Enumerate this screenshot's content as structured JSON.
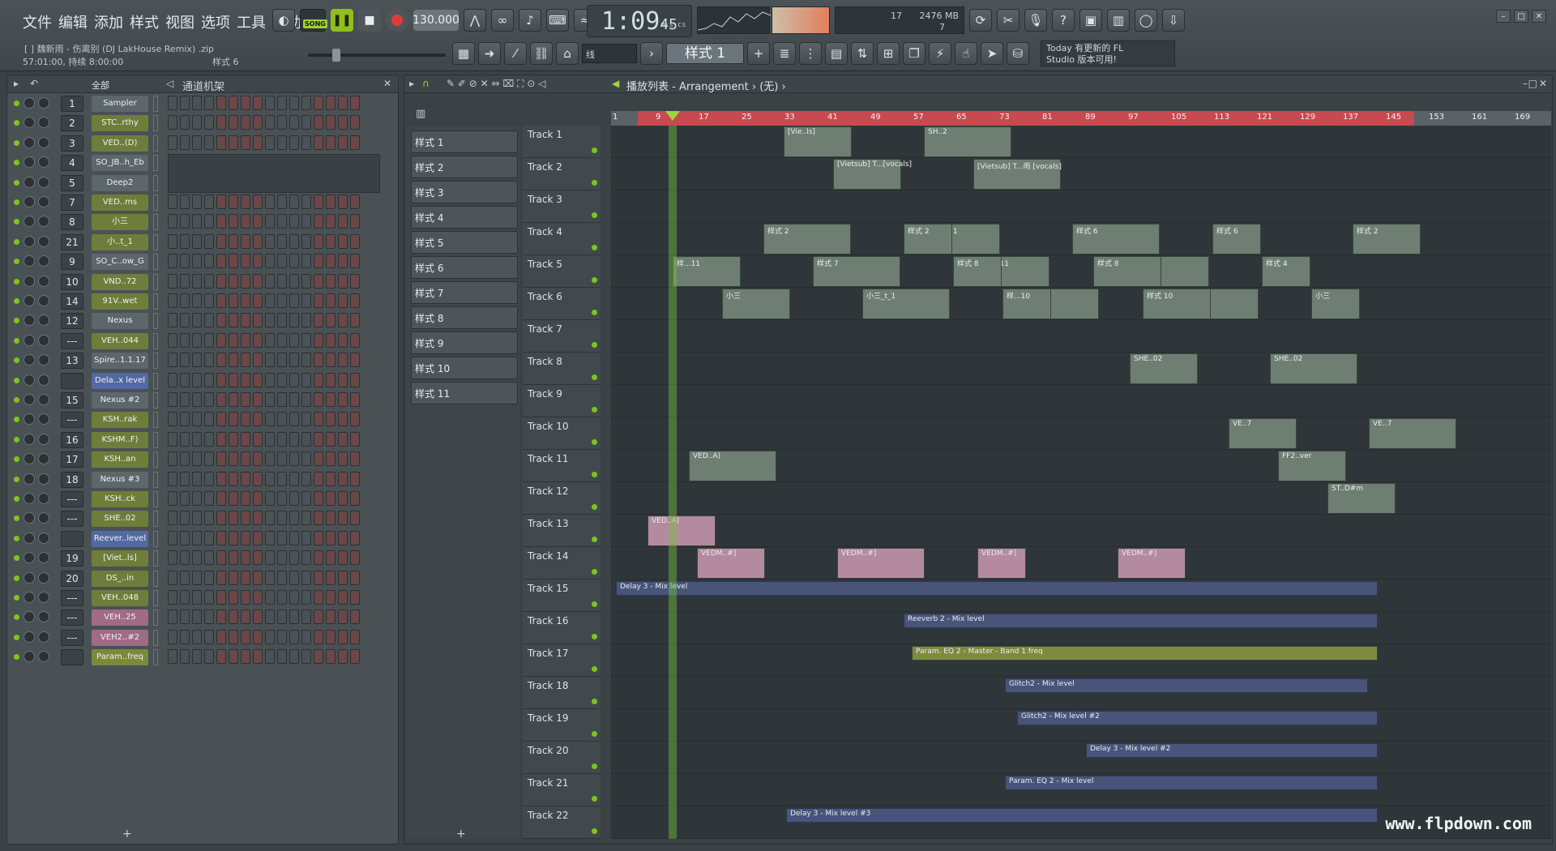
{
  "menu": [
    "文件",
    "编辑",
    "添加",
    "样式",
    "视图",
    "选项",
    "工具",
    "帮助"
  ],
  "song": {
    "title": "[ ] 魏新雨 - 伤离别 (DJ LakHouse Remix) .zip",
    "info": "57:01:00, 持续 8:00:00",
    "pattern": "样式 6"
  },
  "transport": {
    "song_mode": "SONG",
    "tempo": "130.000",
    "time": "1:09",
    "time_sub": "45",
    "time_unit": "M:S:CS"
  },
  "cpu": {
    "poly": "17",
    "mem": "2476 MB",
    "voices": "7"
  },
  "toolbar2": {
    "snap": "线",
    "pattern": "样式 1"
  },
  "news": {
    "line1": "Today  有更新的 FL",
    "line2": "Studio 版本可用!"
  },
  "rack": {
    "filter": "全部",
    "title": "通道机架",
    "channels": [
      {
        "num": "1",
        "name": "Sampler",
        "color": "#5d666a"
      },
      {
        "num": "2",
        "name": "STC..rthy",
        "color": "#6f7d3a"
      },
      {
        "num": "3",
        "name": "VED..(D)",
        "color": "#6f7d3a"
      },
      {
        "num": "4",
        "name": "SO_JB..h_Eb",
        "color": "#5d666a"
      },
      {
        "num": "5",
        "name": "Deep2",
        "color": "#5d666a"
      },
      {
        "num": "7",
        "name": "VED..ms",
        "color": "#6f7d3a"
      },
      {
        "num": "8",
        "name": "小三",
        "color": "#6f7d3a"
      },
      {
        "num": "21",
        "name": "小..t_1",
        "color": "#6f7d3a"
      },
      {
        "num": "9",
        "name": "SO_C..ow_G",
        "color": "#5d666a"
      },
      {
        "num": "10",
        "name": "VND..72",
        "color": "#6f7d3a"
      },
      {
        "num": "14",
        "name": "91V..wet",
        "color": "#6f7d3a"
      },
      {
        "num": "12",
        "name": "Nexus",
        "color": "#5d666a"
      },
      {
        "num": "---",
        "name": "VEH..044",
        "color": "#6f7d3a"
      },
      {
        "num": "13",
        "name": "Spire..1.1.17",
        "color": "#5d666a"
      },
      {
        "num": "",
        "name": "Dela..x level",
        "color": "#536aa0"
      },
      {
        "num": "15",
        "name": "Nexus #2",
        "color": "#5d666a"
      },
      {
        "num": "---",
        "name": "KSH..rak",
        "color": "#6f7d3a"
      },
      {
        "num": "16",
        "name": "KSHM..F)",
        "color": "#6f7d3a"
      },
      {
        "num": "17",
        "name": "KSH..an",
        "color": "#6f7d3a"
      },
      {
        "num": "18",
        "name": "Nexus #3",
        "color": "#5d666a"
      },
      {
        "num": "---",
        "name": "KSH..ck",
        "color": "#6f7d3a"
      },
      {
        "num": "---",
        "name": "SHE..02",
        "color": "#6f7d3a"
      },
      {
        "num": "",
        "name": "Reever..level",
        "color": "#536aa0"
      },
      {
        "num": "19",
        "name": "[Viet..ls]",
        "color": "#6f7d3a"
      },
      {
        "num": "20",
        "name": "DS_..in",
        "color": "#6f7d3a"
      },
      {
        "num": "---",
        "name": "VEH..048",
        "color": "#6f7d3a"
      },
      {
        "num": "---",
        "name": "VEH..25",
        "color": "#a06b86"
      },
      {
        "num": "---",
        "name": "VEH2..#2",
        "color": "#a06b86"
      },
      {
        "num": "",
        "name": "Param..freq",
        "color": "#7a8a3a"
      }
    ]
  },
  "playlist": {
    "title": "播放列表 - Arrangement › (无) ›",
    "patterns": [
      "样式 1",
      "样式 2",
      "样式 3",
      "样式 4",
      "样式 5",
      "样式 6",
      "样式 7",
      "样式 8",
      "样式 9",
      "样式 10",
      "样式 11"
    ],
    "tracks": [
      "Track 1",
      "Track 2",
      "Track 3",
      "Track 4",
      "Track 5",
      "Track 6",
      "Track 7",
      "Track 8",
      "Track 9",
      "Track 10",
      "Track 11",
      "Track 12",
      "Track 13",
      "Track 14",
      "Track 15",
      "Track 16",
      "Track 17",
      "Track 18",
      "Track 19",
      "Track 20",
      "Track 21",
      "Track 22"
    ],
    "ruler": [
      "1",
      "9",
      "17",
      "25",
      "33",
      "41",
      "49",
      "57",
      "65",
      "73",
      "81",
      "89",
      "97",
      "105",
      "113",
      "121",
      "129",
      "137",
      "145",
      "153",
      "161",
      "169"
    ],
    "automation": [
      {
        "track": 14,
        "label": "Delay 3 - Mix level"
      },
      {
        "track": 15,
        "label": "Reeverb 2 - Mix level"
      },
      {
        "track": 16,
        "label": "Param. EQ 2 - Master - Band 1 freq"
      },
      {
        "track": 17,
        "label": "Glitch2 - Mix level"
      },
      {
        "track": 18,
        "label": "Glitch2 - Mix level #2"
      },
      {
        "track": 19,
        "label": "Delay 3 - Mix level #2"
      },
      {
        "track": 20,
        "label": "Param. EQ 2 - Mix level"
      },
      {
        "track": 21,
        "label": "Delay 3 - Mix level #3"
      }
    ],
    "clips": [
      {
        "track": 0,
        "label": "[Vie..ls]"
      },
      {
        "track": 0,
        "label": "SH..2"
      },
      {
        "track": 1,
        "label": "[Vietsub] T...[vocals]"
      },
      {
        "track": 1,
        "label": "[Vietsub] T...雨 [vocals]"
      },
      {
        "track": 3,
        "label": "样式 1"
      },
      {
        "track": 3,
        "label": "样式 6"
      },
      {
        "track": 3,
        "label": "样式 6"
      },
      {
        "track": 3,
        "label": "样式 2"
      },
      {
        "track": 3,
        "label": "样式 2"
      },
      {
        "track": 3,
        "label": "样式 2"
      },
      {
        "track": 4,
        "label": "样...11"
      },
      {
        "track": 4,
        "label": "样式 4"
      },
      {
        "track": 4,
        "label": "样式 4"
      },
      {
        "track": 4,
        "label": "样...11"
      },
      {
        "track": 4,
        "label": "样式 7"
      },
      {
        "track": 4,
        "label": "样式 8"
      },
      {
        "track": 4,
        "label": "样式 8"
      },
      {
        "track": 5,
        "label": "小三"
      },
      {
        "track": 5,
        "label": "小三"
      },
      {
        "track": 5,
        "label": "小三"
      },
      {
        "track": 5,
        "label": "小三"
      },
      {
        "track": 5,
        "label": "小三_t_1"
      },
      {
        "track": 5,
        "label": "样...10"
      },
      {
        "track": 5,
        "label": "样式 10"
      },
      {
        "track": 7,
        "label": "SHE..02"
      },
      {
        "track": 7,
        "label": "SHE..02"
      },
      {
        "track": 9,
        "label": "VE..7"
      },
      {
        "track": 9,
        "label": "VE..7"
      },
      {
        "track": 10,
        "label": "FF2..ver"
      },
      {
        "track": 10,
        "label": "VED..A)"
      },
      {
        "track": 11,
        "label": "ST..D#m"
      },
      {
        "track": 12,
        "label": "VED..A)"
      },
      {
        "track": 13,
        "label": "VEDM..#]"
      },
      {
        "track": 13,
        "label": "VEDM..#]"
      },
      {
        "track": 13,
        "label": "VEDM..#]"
      },
      {
        "track": 13,
        "label": "VEDM..#]"
      }
    ]
  },
  "watermark": "www.flpdown.com"
}
